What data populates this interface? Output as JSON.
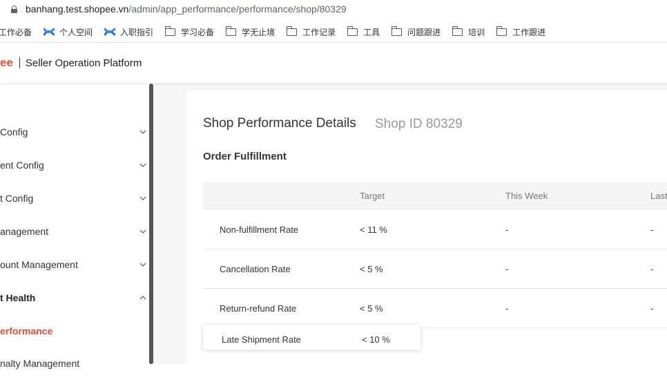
{
  "browser": {
    "url_host": "banhang.test.shopee.vn",
    "url_path": "/admin/app_performance/performance/shop/80329"
  },
  "bookmarks": [
    {
      "label": "工作必备",
      "icon": "none"
    },
    {
      "label": "个人空间",
      "icon": "confluence-icon"
    },
    {
      "label": "入职指引",
      "icon": "confluence-icon"
    },
    {
      "label": "学习必备",
      "icon": "folder-icon"
    },
    {
      "label": "学无止境",
      "icon": "folder-icon"
    },
    {
      "label": "工作记录",
      "icon": "folder-icon"
    },
    {
      "label": "工具",
      "icon": "folder-icon"
    },
    {
      "label": "问题跟进",
      "icon": "folder-icon"
    },
    {
      "label": "培训",
      "icon": "folder-icon"
    },
    {
      "label": "工作跟进",
      "icon": "folder-icon"
    }
  ],
  "header": {
    "brand": "ee",
    "platform": "Seller Operation Platform",
    "brand_color": "#ee4d2d"
  },
  "sidebar": {
    "items": [
      {
        "label": "Config",
        "state": "collapsed"
      },
      {
        "label": "ent Config",
        "state": "collapsed"
      },
      {
        "label": "t Config",
        "state": "collapsed"
      },
      {
        "label": "anagement",
        "state": "collapsed"
      },
      {
        "label": "ount Management",
        "state": "collapsed"
      },
      {
        "label": "t Health",
        "state": "expanded"
      },
      {
        "label": "erformance",
        "state": "active"
      },
      {
        "label": "nalty Management",
        "state": "none"
      }
    ]
  },
  "main": {
    "title": "Shop Performance Details",
    "shop_id": "Shop ID 80329",
    "section": "Order Fulfillment",
    "table": {
      "headers": [
        "",
        "Target",
        "This Week",
        "Last"
      ],
      "rows": [
        {
          "metric": "Non-fulfillment Rate",
          "target": "< 11 %",
          "this_week": "-",
          "last": "-"
        },
        {
          "metric": "Cancellation Rate",
          "target": "< 5 %",
          "this_week": "-",
          "last": "-"
        },
        {
          "metric": "Return-refund Rate",
          "target": "< 5 %",
          "this_week": "-",
          "last": "-"
        },
        {
          "metric": "Late Shipment Rate",
          "target": "< 10 %"
        }
      ]
    }
  }
}
